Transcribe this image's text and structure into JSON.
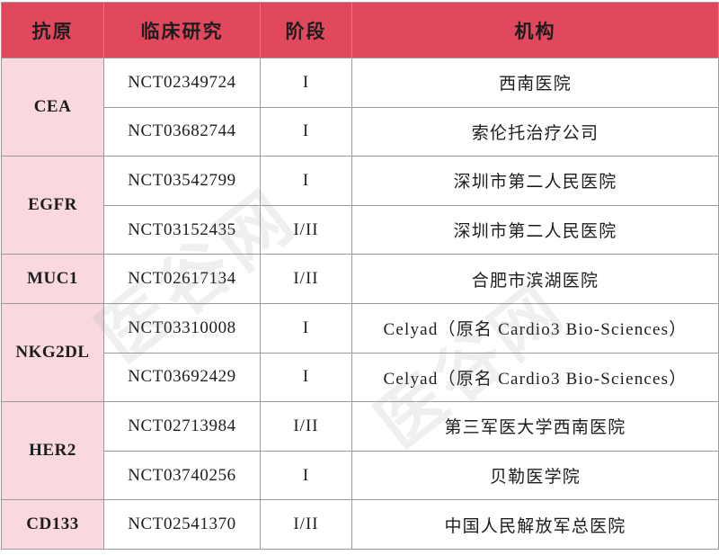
{
  "table": {
    "headers": [
      "抗原",
      "临床研究",
      "阶段",
      "机构"
    ],
    "groups": [
      {
        "antigen": "CEA",
        "rows": [
          {
            "nct": "NCT02349724",
            "phase": "I",
            "institution": "西南医院"
          },
          {
            "nct": "NCT03682744",
            "phase": "I",
            "institution": "索伦托治疗公司"
          }
        ]
      },
      {
        "antigen": "EGFR",
        "rows": [
          {
            "nct": "NCT03542799",
            "phase": "I",
            "institution": "深圳市第二人民医院"
          },
          {
            "nct": "NCT03152435",
            "phase": "I/II",
            "institution": "深圳市第二人民医院"
          }
        ]
      },
      {
        "antigen": "MUC1",
        "rows": [
          {
            "nct": "NCT02617134",
            "phase": "I/II",
            "institution": "合肥市滨湖医院"
          }
        ]
      },
      {
        "antigen": "NKG2DL",
        "rows": [
          {
            "nct": "NCT03310008",
            "phase": "I",
            "institution": "Celyad（原名 Cardio3 Bio-Sciences）"
          },
          {
            "nct": "NCT03692429",
            "phase": "I",
            "institution": "Celyad（原名 Cardio3 Bio-Sciences）"
          }
        ]
      },
      {
        "antigen": "HER2",
        "rows": [
          {
            "nct": "NCT02713984",
            "phase": "I/II",
            "institution": "第三军医大学西南医院"
          },
          {
            "nct": "NCT03740256",
            "phase": "I",
            "institution": "贝勒医学院"
          }
        ]
      },
      {
        "antigen": "CD133",
        "rows": [
          {
            "nct": "NCT02541370",
            "phase": "I/II",
            "institution": "中国人民解放军总医院"
          }
        ]
      }
    ]
  },
  "watermark": {
    "line1": "医谷网",
    "line2": "医谷网"
  },
  "colors": {
    "header_bg": "#e2485d",
    "antigen_bg": "#f9d9df",
    "border": "#9b9b9b",
    "text": "#1d1d1d",
    "header_text": "#ffffff"
  }
}
